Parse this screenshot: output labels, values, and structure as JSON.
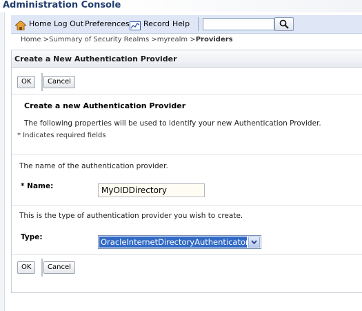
{
  "console_title": "Administration Console",
  "toolbar": {
    "home": "Home",
    "logout": "Log Out",
    "preferences": "Preferences",
    "record": "Record",
    "help": "Help",
    "search_value": ""
  },
  "breadcrumb": {
    "home": "Home",
    "summary": "Summary of Security Realms",
    "realm": "myrealm",
    "current": "Providers",
    "separator": ">"
  },
  "panel": {
    "title": "Create a New Authentication Provider",
    "ok_label": "OK",
    "cancel_label": "Cancel",
    "section_title": "Create a new Authentication Provider",
    "description": "The following properties will be used to identify your new Authentication Provider.",
    "required_note": "* Indicates required fields",
    "name_help": "The name of the authentication provider.",
    "name_label": "Name:",
    "name_required_mark": "*",
    "name_value": "MyOIDDirectory",
    "type_help": "This is the type of authentication provider you wish to create.",
    "type_label": "Type:",
    "type_value": "OracleInternetDirectoryAuthenticator"
  },
  "colors": {
    "toolbar_bg": "#dfe7f7",
    "title_blue": "#1f3c6e",
    "selection": "#316ac5"
  }
}
